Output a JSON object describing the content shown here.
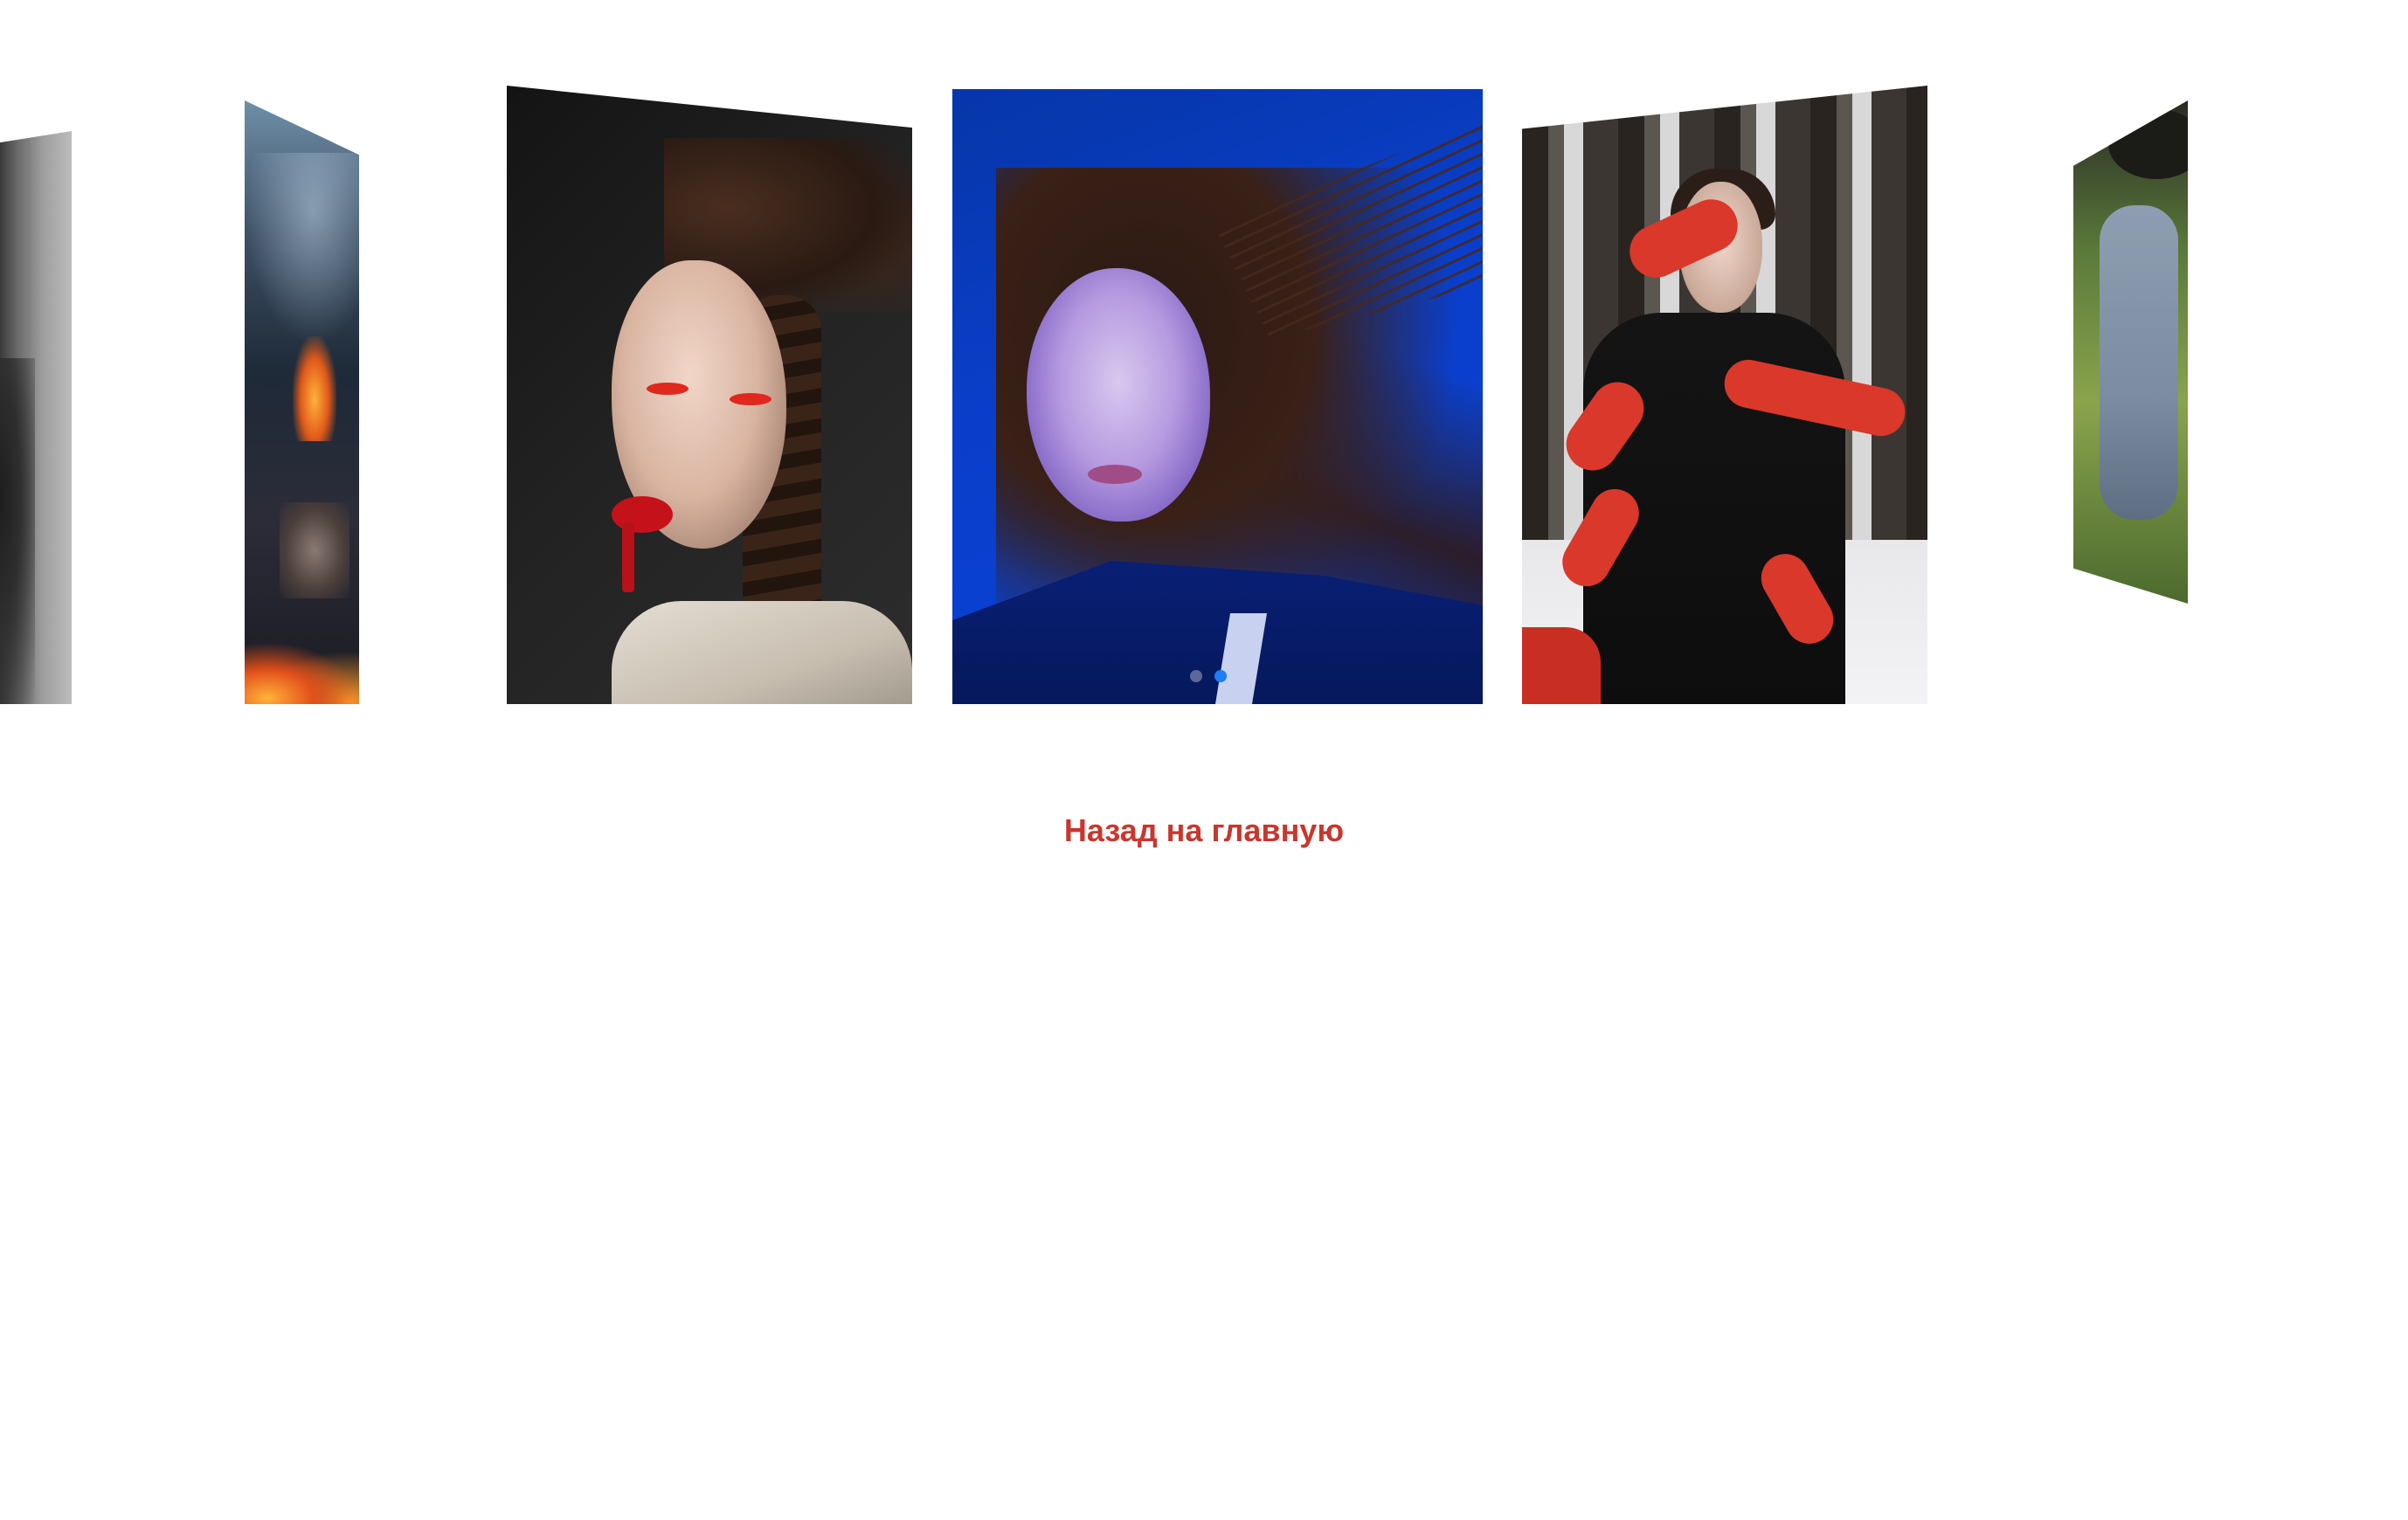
{
  "gallery": {
    "slides": [
      {
        "name": "grayscale-portrait",
        "position": "far-left"
      },
      {
        "name": "fire-portrait",
        "position": "left"
      },
      {
        "name": "red-lips-portrait",
        "position": "left-center"
      },
      {
        "name": "blue-portrait",
        "position": "center"
      },
      {
        "name": "red-hands-portrait",
        "position": "right-center"
      },
      {
        "name": "outdoor-portrait",
        "position": "far-right"
      }
    ],
    "pagination": {
      "active_index": 0,
      "count": 2,
      "active_color": "#1e7cf5"
    }
  },
  "navigation": {
    "back_link_label": "Назад на главную",
    "back_link_color": "#c8372d"
  }
}
